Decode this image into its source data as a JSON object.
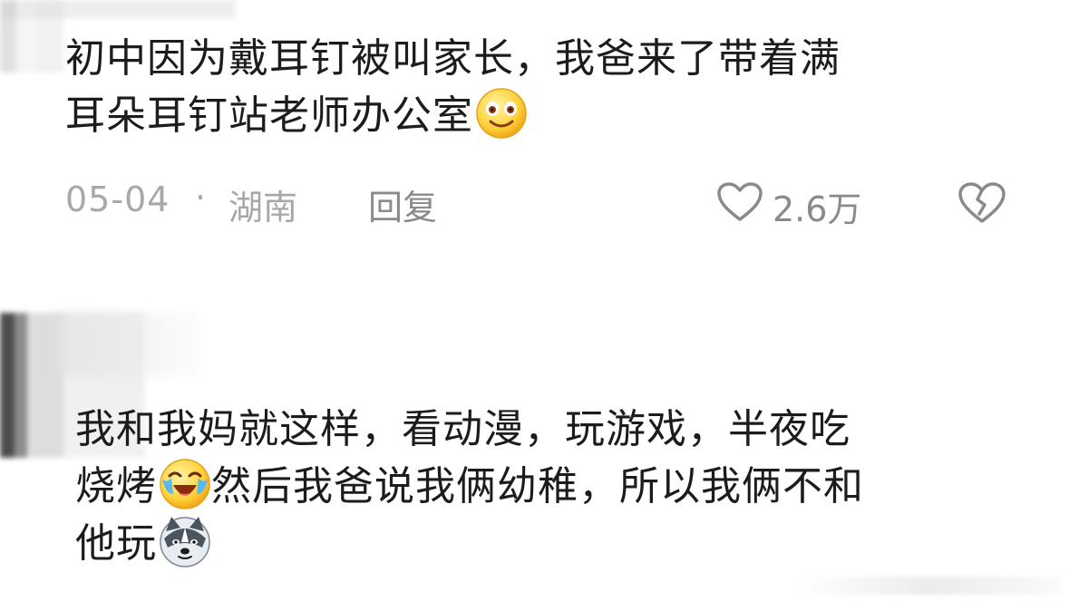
{
  "comments": [
    {
      "line1": "初中因为戴耳钉被叫家长，我爸来了带着满",
      "line2": "耳朵耳钉站老师办公室",
      "emoji_end": "smiling-dizzy-eyes-emoji",
      "meta": {
        "date": "05-04",
        "separator": "·",
        "location": "湖南",
        "reply_label": "回复",
        "like_count": "2.6万",
        "like_icon": "heart-outline-icon",
        "dislike_icon": "broken-heart-icon"
      }
    },
    {
      "line1": "我和我妈就这样，看动漫，玩游戏，半夜吃",
      "line2_pre": "烧烤",
      "emoji_mid": "laughing-crying-emoji",
      "line2_post": "然后我爸说我俩幼稚，所以我俩不和",
      "line3": "他玩",
      "emoji_end": "husky-dog-emoji"
    }
  ],
  "colors": {
    "text": "#1c1c1c",
    "meta_text": "#a8a8a8",
    "icon_gray": "#8a8a8a",
    "emoji_yellow": "#ffd23a"
  }
}
